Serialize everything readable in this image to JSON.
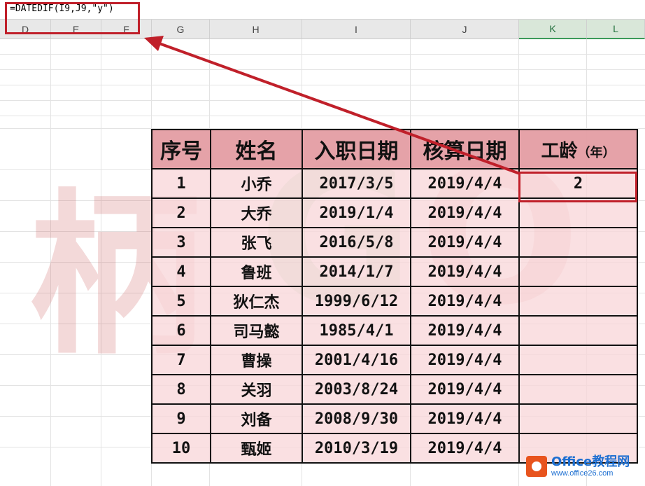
{
  "formula_bar": {
    "formula": "=DATEDIF(I9,J9,\"y\")"
  },
  "columns": [
    "D",
    "E",
    "F",
    "G",
    "H",
    "I",
    "J",
    "K",
    "L"
  ],
  "watermark": {
    "chars": [
      "柄",
      "G",
      "O"
    ]
  },
  "table": {
    "headers": [
      "序号",
      "姓名",
      "入职日期",
      "核算日期",
      "工龄",
      "（年）"
    ],
    "rows": [
      {
        "no": "1",
        "name": "小乔",
        "hire": "2017/3/5",
        "calc": "2019/4/4",
        "years": "2"
      },
      {
        "no": "2",
        "name": "大乔",
        "hire": "2019/1/4",
        "calc": "2019/4/4",
        "years": ""
      },
      {
        "no": "3",
        "name": "张飞",
        "hire": "2016/5/8",
        "calc": "2019/4/4",
        "years": ""
      },
      {
        "no": "4",
        "name": "鲁班",
        "hire": "2014/1/7",
        "calc": "2019/4/4",
        "years": ""
      },
      {
        "no": "5",
        "name": "狄仁杰",
        "hire": "1999/6/12",
        "calc": "2019/4/4",
        "years": ""
      },
      {
        "no": "6",
        "name": "司马懿",
        "hire": "1985/4/1",
        "calc": "2019/4/4",
        "years": ""
      },
      {
        "no": "7",
        "name": "曹操",
        "hire": "2001/4/16",
        "calc": "2019/4/4",
        "years": ""
      },
      {
        "no": "8",
        "name": "关羽",
        "hire": "2003/8/24",
        "calc": "2019/4/4",
        "years": ""
      },
      {
        "no": "9",
        "name": "刘备",
        "hire": "2008/9/30",
        "calc": "2019/4/4",
        "years": ""
      },
      {
        "no": "10",
        "name": "甄姬",
        "hire": "2010/3/19",
        "calc": "2019/4/4",
        "years": ""
      }
    ]
  },
  "logo": {
    "brand": "Office教程网",
    "url": "www.office26.com"
  },
  "colors": {
    "header_fill": "#e0969e",
    "cell_fill": "#f8d7da",
    "highlight": "#c0202a",
    "selected_column": "#d9e7d9"
  }
}
